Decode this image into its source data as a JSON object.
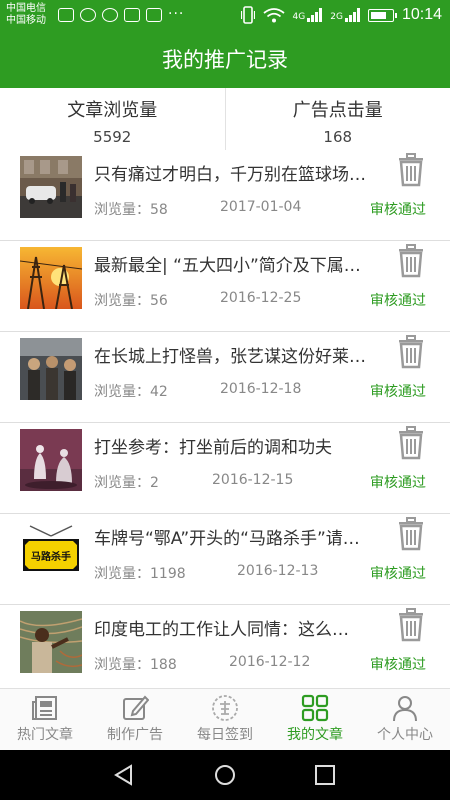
{
  "status_bar": {
    "carrier_1": "中国电信",
    "carrier_2": "中国移动",
    "net_top": "4G",
    "net_bottom": "2G",
    "time": "10:14",
    "more": "···"
  },
  "header": {
    "title": "我的推广记录"
  },
  "stats": {
    "article_views_label": "文章浏览量",
    "article_views_value": "5592",
    "ad_clicks_label": "广告点击量",
    "ad_clicks_value": "168"
  },
  "articles": [
    {
      "title": "只有痛过才明白，千万别在篮球场…",
      "views_label": "浏览量：",
      "views": "58",
      "date": "2017-01-04",
      "status": "审核通过"
    },
    {
      "title": "最新最全| “五大四小”简介及下属…",
      "views_label": "浏览量：",
      "views": "56",
      "date": "2016-12-25",
      "status": "审核通过"
    },
    {
      "title": "在长城上打怪兽，张艺谋这份好莱坞…",
      "views_label": "浏览量：",
      "views": "42",
      "date": "2016-12-18",
      "status": "审核通过"
    },
    {
      "title": "打坐参考：打坐前后的调和功夫",
      "views_label": "浏览量：",
      "views": "2",
      "date": "2016-12-15",
      "status": "审核通过"
    },
    {
      "title": "车牌号“鄂A”开头的“马路杀手”请…",
      "views_label": "浏览量：",
      "views": "1198",
      "date": "2016-12-13",
      "status": "审核通过"
    },
    {
      "title": "印度电工的工作让人同情：这么…",
      "views_label": "浏览量：",
      "views": "188",
      "date": "2016-12-12",
      "status": "审核通过"
    }
  ],
  "thumb_sign_text": "马路杀手",
  "bottom_nav": [
    {
      "label": "热门文章",
      "icon": "newspaper-icon"
    },
    {
      "label": "制作广告",
      "icon": "edit-icon"
    },
    {
      "label": "每日签到",
      "icon": "sign-in-icon"
    },
    {
      "label": "我的文章",
      "icon": "grid-icon",
      "active": true
    },
    {
      "label": "个人中心",
      "icon": "person-icon"
    }
  ],
  "colors": {
    "brand_green": "#2e9c22",
    "status_green": "#2e9c22",
    "trash_gray": "#9a9a9a"
  }
}
